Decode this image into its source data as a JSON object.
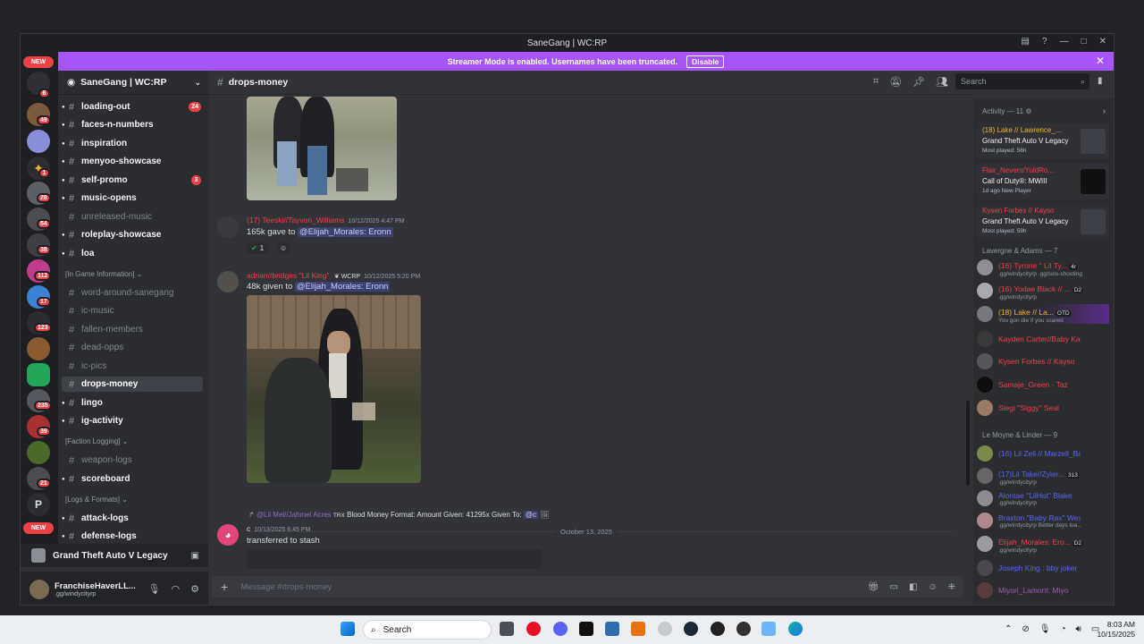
{
  "window": {
    "title": "SaneGang | WC:RP"
  },
  "banner": {
    "text": "Streamer Mode is enabled. Usernames have been truncated.",
    "button": "Disable"
  },
  "guild_badges": [
    "NEW",
    "6",
    "49",
    "1",
    "28",
    "54",
    "38",
    "112",
    "17",
    "123",
    "235",
    "39",
    "21",
    "P",
    "NEW"
  ],
  "server": {
    "name": "SaneGang | WC:RP"
  },
  "channels": [
    {
      "name": "loading-out",
      "badge": "24",
      "muted": false
    },
    {
      "name": "faces-n-numbers",
      "muted": false
    },
    {
      "name": "inspiration",
      "muted": false
    },
    {
      "name": "menyoo-showcase",
      "muted": false
    },
    {
      "name": "self-promo",
      "badge": "3",
      "muted": false
    },
    {
      "name": "music-opens",
      "muted": false
    },
    {
      "name": "unreleased-music",
      "muted": true
    },
    {
      "name": "roleplay-showcase",
      "muted": false
    },
    {
      "name": "loa",
      "muted": false
    },
    {
      "name": "word-around-sanegang",
      "muted": true
    },
    {
      "name": "ic-music",
      "muted": true
    },
    {
      "name": "fallen-members",
      "muted": true
    },
    {
      "name": "dead-opps",
      "muted": true
    },
    {
      "name": "ic-pics",
      "muted": true
    },
    {
      "name": "drops-money",
      "selected": true
    },
    {
      "name": "lingo",
      "muted": false
    },
    {
      "name": "ig-activity",
      "muted": false
    },
    {
      "name": "weapon-logs",
      "muted": true
    },
    {
      "name": "scoreboard",
      "muted": false
    },
    {
      "name": "attack-logs",
      "muted": false
    },
    {
      "name": "defense-logs",
      "muted": false
    }
  ],
  "categories": [
    "[In Game Information]",
    "[Faction Logging]",
    "[Logs & Formats]"
  ],
  "voice_panel": {
    "game": "Grand Theft Auto V Legacy"
  },
  "user_panel": {
    "name": "FranchiseHaverLL...",
    "status": ".gg/windycityrp"
  },
  "chat": {
    "channel": "drops-money",
    "search_placeholder": "Search",
    "messages": [
      {
        "author": "(17) Teeski//Tayvon_Williams",
        "time": "10/12/2025 4:47 PM",
        "text": "165k gave to",
        "mention": "@Elijah_Morales: Eronn",
        "reactions": [
          "1"
        ]
      },
      {
        "author": "adrian//bridges \"Lil King\"",
        "tag": "WCRP",
        "time": "10/12/2025 5:20 PM",
        "text": "48k given to",
        "mention": "@Elijah_Morales: Eronn"
      },
      {
        "reply": "@Lil Mel//Jahmel Acres",
        "reply_tag": "TRX",
        "reply_text": "Blood Money Format:   Amount Given: 41295x Given To:",
        "reply_mention": "@c",
        "author": "c",
        "time": "10/13/2025 6:45 PM",
        "text": "transferred to stash"
      }
    ],
    "date_divider": "October 13, 2025",
    "composer_placeholder": "Message #drops-money"
  },
  "members": {
    "activity_title": "Activity — 11",
    "activities": [
      {
        "name": "(18) Lake // Lawrence_...",
        "game": "Grand Theft Auto V Legacy",
        "sub": "Most played: 56h"
      },
      {
        "name": "Flair_Nevem/YuldRo...",
        "game": "Call of Duty®: MWIII",
        "sub": "1d ago   New Player"
      },
      {
        "name": "Kysen Forbes // Kayso",
        "game": "Grand Theft Auto V Legacy",
        "sub": "Most played: 59h"
      }
    ],
    "groups": [
      {
        "title": "Lavergne & Adams — 7",
        "items": [
          {
            "name": "(16) Tyrone \" Lil Ty...",
            "tag": "4r",
            "sub": ".gg/windycityrp .gg/sols-shooting"
          },
          {
            "name": "(16) Yodae Black // ...",
            "tag": "D2",
            "sub": ".gg/windycityrp"
          },
          {
            "name": "(18) Lake // La...",
            "tag": "OTD",
            "sub": "You gon die if you scared"
          },
          {
            "name": "Kayden Carter//Baby Kay"
          },
          {
            "name": "Kysen Forbes // Kayso"
          },
          {
            "name": "Samaje_Green - Taz"
          },
          {
            "name": "Siegi \"Siggy\" Seal"
          }
        ]
      },
      {
        "title": "Le Moyne & Linder — 9",
        "items": [
          {
            "name": "(16) Lil Zell // Marzell_Ba..."
          },
          {
            "name": "(17)Lil Take//Zyler...",
            "tag": "313",
            "sub": ".gg/windycityrp"
          },
          {
            "name": "Alontae \"LilHot\" Blake",
            "sub": ".gg/windycityrp"
          },
          {
            "name": "Braxton \"Baby Rax\" West...",
            "sub": ".gg/windycityrp Better days loa..."
          },
          {
            "name": "Elijah_Morales: Ero...",
            "tag": "D2",
            "sub": ".gg/windycityrp"
          },
          {
            "name": "Joseph King : bby joker"
          },
          {
            "name": "Miyori_Lamont: Miyo"
          }
        ]
      }
    ]
  },
  "taskbar": {
    "search": "Search",
    "time": "8:03 AM",
    "date": "10/15/2025"
  }
}
